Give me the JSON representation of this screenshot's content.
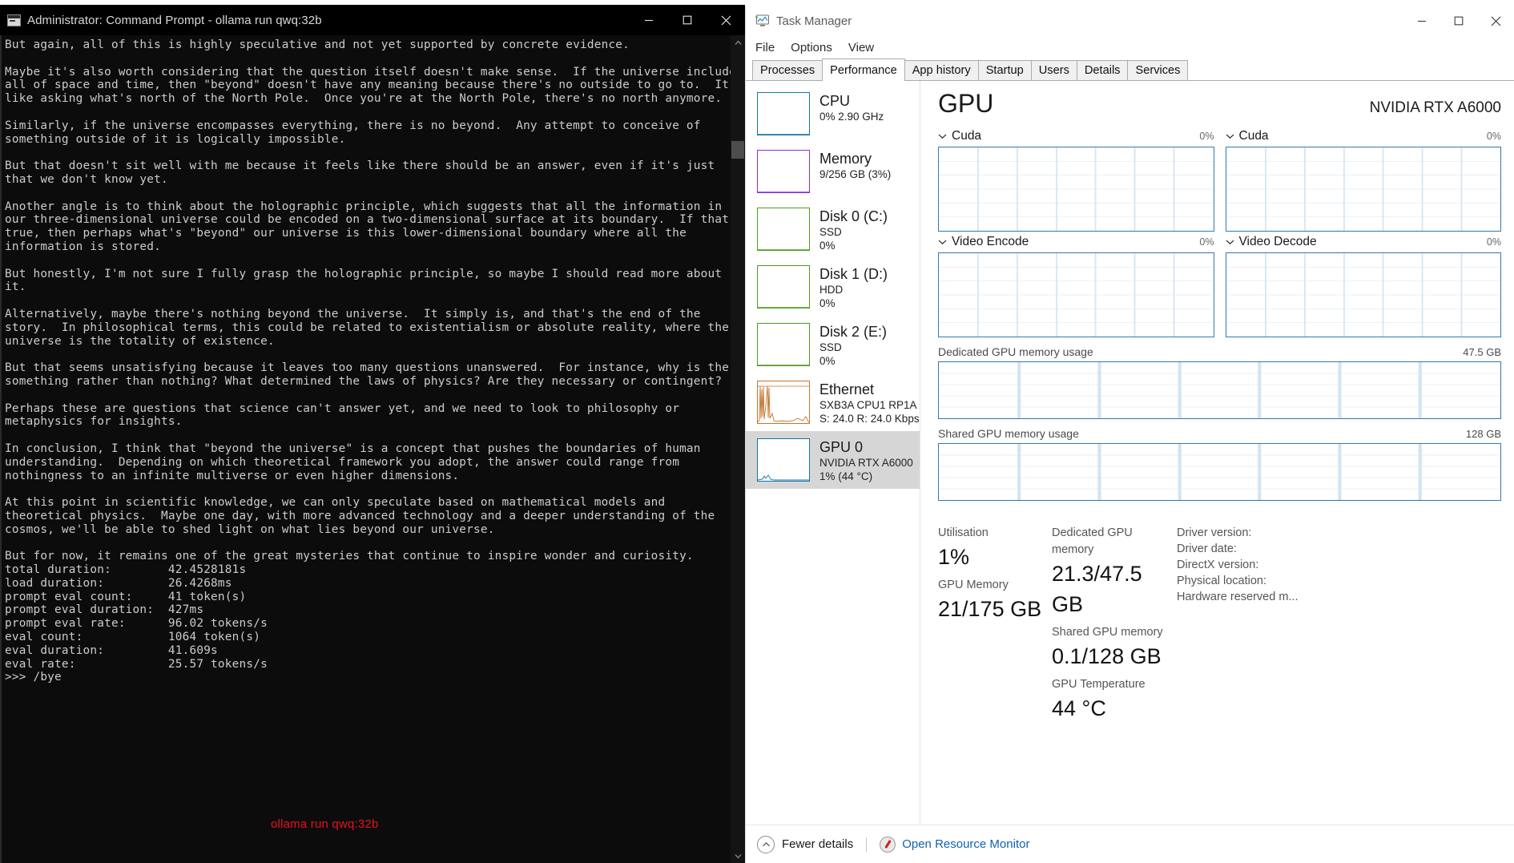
{
  "console": {
    "title": "Administrator: Command Prompt - ollama  run qwq:32b",
    "icon": "console-icon",
    "window_controls": {
      "minimize": "minimize-icon",
      "maximize": "maximize-icon",
      "close": "close-icon"
    },
    "output": "But again, all of this is highly speculative and not yet supported by concrete evidence.\n\nMaybe it's also worth considering that the question itself doesn't make sense.  If the universe includes\nall of space and time, then \"beyond\" doesn't have any meaning because there's no outside to go to.  It's\nlike asking what's north of the North Pole.  Once you're at the North Pole, there's no north anymore.\n\nSimilarly, if the universe encompasses everything, there is no beyond.  Any attempt to conceive of\nsomething outside of it is logically impossible.\n\nBut that doesn't sit well with me because it feels like there should be an answer, even if it's just\nthat we don't know yet.\n\nAnother angle is to think about the holographic principle, which suggests that all the information in\nour three-dimensional universe could be encoded on a two-dimensional surface at its boundary.  If that's\ntrue, then perhaps what's \"beyond\" our universe is this lower-dimensional boundary where all the\ninformation is stored.\n\nBut honestly, I'm not sure I fully grasp the holographic principle, so maybe I should read more about\nit.\n\nAlternatively, maybe there's nothing beyond the universe.  It simply is, and that's the end of the\nstory.  In philosophical terms, this could be related to existentialism or absolute reality, where the\nuniverse is the totality of existence.\n\nBut that seems unsatisfying because it leaves too many questions unanswered.  For instance, why is there\nsomething rather than nothing? What determined the laws of physics? Are they necessary or contingent?\n\nPerhaps these are questions that science can't answer yet, and we need to look to philosophy or\nmetaphysics for insights.\n\nIn conclusion, I think that \"beyond the universe\" is a concept that pushes the boundaries of human\nunderstanding.  Depending on which theoretical framework you adopt, the answer could range from\nnothingness to an infinite multiverse or even higher dimensions.\n\nAt this point in scientific knowledge, we can only speculate based on mathematical models and\ntheoretical physics.  Maybe one day, with more advanced technology and a deeper understanding of the\ncosmos, we'll be able to shed light on what lies beyond our universe.\n\nBut for now, it remains one of the great mysteries that continue to inspire wonder and curiosity.\n",
    "stats": [
      {
        "label": "total duration:",
        "value": "42.4528181s"
      },
      {
        "label": "load duration:",
        "value": "26.4268ms"
      },
      {
        "label": "prompt eval count:",
        "value": "41 token(s)"
      },
      {
        "label": "prompt eval duration:",
        "value": "427ms"
      },
      {
        "label": "prompt eval rate:",
        "value": "96.02 tokens/s"
      },
      {
        "label": "eval count:",
        "value": "1064 token(s)"
      },
      {
        "label": "eval duration:",
        "value": "41.609s"
      },
      {
        "label": "eval rate:",
        "value": "25.57 tokens/s"
      }
    ],
    "annotation": "ollama run qwq:32b",
    "annotation_color": "#e81123",
    "prompt_line": ">>> /bye"
  },
  "taskmgr": {
    "title": "Task Manager",
    "app_icon": "taskmanager-icon",
    "window_controls": {
      "minimize": "minimize-icon",
      "maximize": "maximize-icon",
      "close": "close-icon"
    },
    "menu": [
      "File",
      "Options",
      "View"
    ],
    "tabs": [
      {
        "label": "Processes",
        "active": false
      },
      {
        "label": "Performance",
        "active": true
      },
      {
        "label": "App history",
        "active": false
      },
      {
        "label": "Startup",
        "active": false
      },
      {
        "label": "Users",
        "active": false
      },
      {
        "label": "Details",
        "active": false
      },
      {
        "label": "Services",
        "active": false
      }
    ],
    "sidebar": [
      {
        "name": "CPU",
        "lines": [
          "0% 2.90 GHz"
        ],
        "color": "#1675a9",
        "selected": false,
        "graph": "flat"
      },
      {
        "name": "Memory",
        "lines": [
          "9/256 GB (3%)"
        ],
        "color": "#8a2be2",
        "selected": false,
        "graph": "flat"
      },
      {
        "name": "Disk 0 (C:)",
        "lines": [
          "SSD",
          "0%"
        ],
        "color": "#4f9c20",
        "selected": false,
        "graph": "flat"
      },
      {
        "name": "Disk 1 (D:)",
        "lines": [
          "HDD",
          "0%"
        ],
        "color": "#4f9c20",
        "selected": false,
        "graph": "flat"
      },
      {
        "name": "Disk 2 (E:)",
        "lines": [
          "SSD",
          "0%"
        ],
        "color": "#4f9c20",
        "selected": false,
        "graph": "flat"
      },
      {
        "name": "Ethernet",
        "lines": [
          "SXB3A CPU1 RP1A …",
          "S: 24.0 R: 24.0 Kbps"
        ],
        "color": "#c8732b",
        "selected": false,
        "graph": "spiky"
      },
      {
        "name": "GPU 0",
        "lines": [
          "NVIDIA RTX A6000",
          "1% (44 °C)"
        ],
        "color": "#1675a9",
        "selected": true,
        "graph": "low"
      }
    ],
    "gpu": {
      "heading": "GPU",
      "model": "NVIDIA RTX A6000",
      "engines": [
        {
          "label": "Cuda",
          "pct": "0%"
        },
        {
          "label": "Cuda",
          "pct": "0%"
        },
        {
          "label": "Video Encode",
          "pct": "0%"
        },
        {
          "label": "Video Decode",
          "pct": "0%"
        }
      ],
      "memory_graphs": [
        {
          "label": "Dedicated GPU memory usage",
          "max": "47.5 GB"
        },
        {
          "label": "Shared GPU memory usage",
          "max": "128 GB"
        }
      ],
      "stats": [
        {
          "name": "Utilisation",
          "value": "1%"
        },
        {
          "name": "Dedicated GPU memory",
          "value": "21.3/47.5 GB"
        },
        {
          "name": "GPU Memory",
          "value": "21/175 GB"
        },
        {
          "name": "Shared GPU memory",
          "value": "0.1/128 GB"
        },
        {
          "name": "GPU Temperature",
          "value": "44 °C"
        }
      ],
      "info": [
        "Driver version:",
        "Driver date:",
        "DirectX version:",
        "Physical location:",
        "Hardware reserved m..."
      ]
    },
    "status": {
      "fewer_details": "Fewer details",
      "open_resource_monitor": "Open Resource Monitor"
    }
  }
}
